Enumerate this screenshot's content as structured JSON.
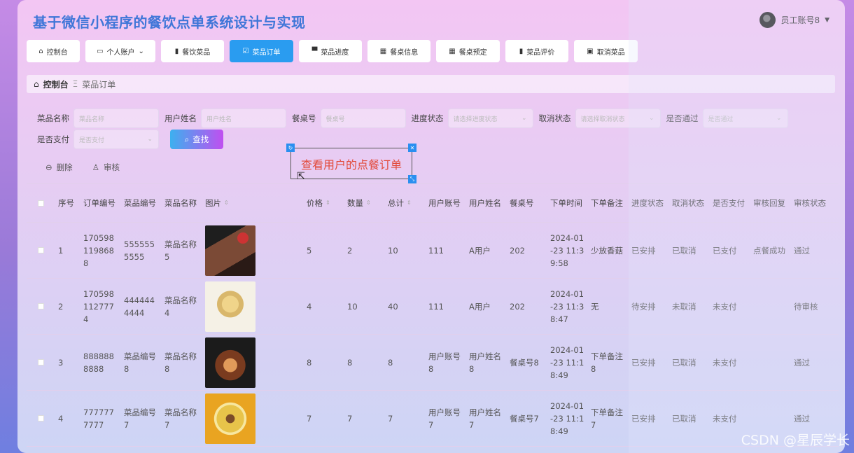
{
  "app_title": "基于微信小程序的餐饮点单系统设计与实现",
  "user": {
    "name": "员工账号8"
  },
  "nav": [
    {
      "label": "控制台",
      "icon": "home-icon"
    },
    {
      "label": "个人账户",
      "icon": "account-icon",
      "dropdown": true
    },
    {
      "label": "餐饮菜品",
      "icon": "book-icon"
    },
    {
      "label": "菜品订单",
      "icon": "order-icon",
      "active": true
    },
    {
      "label": "菜品进度",
      "icon": "progress-icon"
    },
    {
      "label": "餐桌信息",
      "icon": "grid-icon"
    },
    {
      "label": "餐桌预定",
      "icon": "grid-icon"
    },
    {
      "label": "菜品评价",
      "icon": "chart-icon"
    },
    {
      "label": "取消菜品",
      "icon": "clipboard-icon"
    }
  ],
  "breadcrumb": {
    "home": "控制台",
    "current": "菜品订单"
  },
  "filters": {
    "dish_name": {
      "label": "菜品名称",
      "placeholder": "菜品名称"
    },
    "user_name": {
      "label": "用户姓名",
      "placeholder": "用户姓名"
    },
    "table_no": {
      "label": "餐桌号",
      "placeholder": "餐桌号"
    },
    "progress": {
      "label": "进度状态",
      "placeholder": "请选择进度状态"
    },
    "cancel": {
      "label": "取消状态",
      "placeholder": "请选择取消状态"
    },
    "approved": {
      "label": "是否通过",
      "placeholder": "是否通过"
    },
    "paid": {
      "label": "是否支付",
      "placeholder": "是否支付"
    },
    "search_label": "查找"
  },
  "actions": {
    "delete": "删除",
    "review": "审核"
  },
  "annotation": "查看用户的点餐订单",
  "table": {
    "headers": {
      "idx": "序号",
      "order_no": "订单编号",
      "dish_code": "菜品编号",
      "dish_name": "菜品名称",
      "image": "图片",
      "price": "价格",
      "qty": "数量",
      "total": "总计",
      "account": "用户账号",
      "user_name": "用户姓名",
      "table_no": "餐桌号",
      "time": "下单时间",
      "note": "下单备注",
      "progress": "进度状态",
      "cancel": "取消状态",
      "paid": "是否支付",
      "reply": "审核回复",
      "review": "审核状态"
    },
    "rows": [
      {
        "idx": "1",
        "order_no": "1705981198688",
        "dish_code": "5555555555",
        "dish_name": "菜品名称5",
        "image": "steak",
        "price": "5",
        "qty": "2",
        "total": "10",
        "account": "111",
        "user_name": "A用户",
        "table_no": "202",
        "time": "2024-01-23 11:39:58",
        "note": "少放香菇",
        "progress": "已安排",
        "cancel": "已取消",
        "paid": "已支付",
        "reply": "点餐成功",
        "review": "通过"
      },
      {
        "idx": "2",
        "order_no": "1705981127774",
        "dish_code": "4444444444",
        "dish_name": "菜品名称4",
        "image": "basket-salad",
        "price": "4",
        "qty": "10",
        "total": "40",
        "account": "111",
        "user_name": "A用户",
        "table_no": "202",
        "time": "2024-01-23 11:38:47",
        "note": "无",
        "progress": "待安排",
        "cancel": "未取消",
        "paid": "未支付",
        "reply": "",
        "review": "待审核"
      },
      {
        "idx": "3",
        "order_no": "8888888888",
        "dish_code": "菜品编号8",
        "dish_name": "菜品名称8",
        "image": "noodle-bowl",
        "price": "8",
        "qty": "8",
        "total": "8",
        "account": "用户账号8",
        "user_name": "用户姓名8",
        "table_no": "餐桌号8",
        "time": "2024-01-23 11:18:49",
        "note": "下单备注8",
        "progress": "已安排",
        "cancel": "已取消",
        "paid": "未支付",
        "reply": "",
        "review": "通过"
      },
      {
        "idx": "4",
        "order_no": "7777777777",
        "dish_code": "菜品编号7",
        "dish_name": "菜品名称7",
        "image": "fried-dish",
        "price": "7",
        "qty": "7",
        "total": "7",
        "account": "用户账号7",
        "user_name": "用户姓名7",
        "table_no": "餐桌号7",
        "time": "2024-01-23 11:18:49",
        "note": "下单备注7",
        "progress": "已安排",
        "cancel": "已取消",
        "paid": "未支付",
        "reply": "",
        "review": "通过"
      }
    ]
  },
  "watermark": "CSDN @星辰学长"
}
